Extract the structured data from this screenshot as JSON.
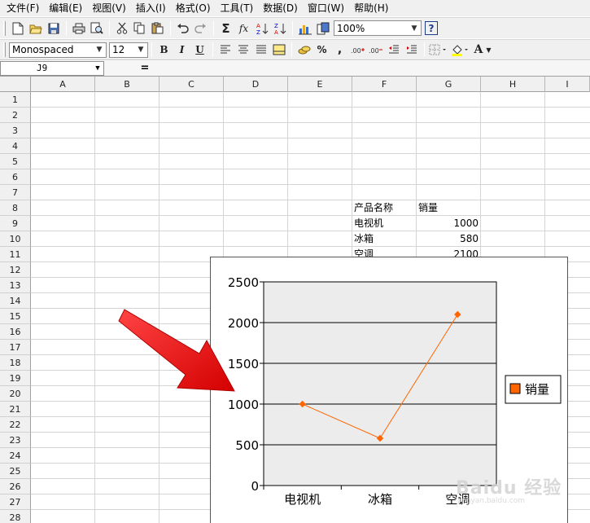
{
  "menu": [
    "文件(F)",
    "编辑(E)",
    "视图(V)",
    "插入(I)",
    "格式(O)",
    "工具(T)",
    "数据(D)",
    "窗口(W)",
    "帮助(H)"
  ],
  "toolbar1": {
    "zoom_value": "100%",
    "icons": [
      "new-file-icon",
      "open-folder-icon",
      "save-icon",
      "print-icon",
      "print-preview-icon",
      "cut-icon",
      "copy-icon",
      "paste-icon",
      "undo-icon",
      "redo-icon",
      "sum-icon",
      "function-icon",
      "sort-ascending-icon",
      "sort-descending-icon",
      "chart-icon",
      "navigator-icon",
      "help-icon"
    ],
    "sum_glyph": "Σ",
    "function_glyph": "fx",
    "help_glyph": "?"
  },
  "toolbar2": {
    "font_name": "Monospaced",
    "font_size": "12",
    "bold": "B",
    "italic": "I",
    "underline": "U",
    "percent": "%",
    "comma": ",",
    "font_color_glyph": "A"
  },
  "formula_bar": {
    "cell_ref": "J9",
    "equals": "="
  },
  "columns": [
    "A",
    "B",
    "C",
    "D",
    "E",
    "F",
    "G",
    "H",
    "I"
  ],
  "rows": [
    "1",
    "2",
    "3",
    "4",
    "5",
    "6",
    "7",
    "8",
    "9",
    "10",
    "11",
    "12",
    "13",
    "14",
    "15",
    "16",
    "17",
    "18",
    "19",
    "20",
    "21",
    "22",
    "23",
    "24",
    "25",
    "26",
    "27",
    "28"
  ],
  "cells": {
    "F8": "产品名称",
    "G8": "销量",
    "F9": "电视机",
    "G9": "1000",
    "F10": "冰箱",
    "G10": "580",
    "F11": "空调",
    "G11": "2100"
  },
  "chart_data": {
    "type": "line",
    "categories": [
      "电视机",
      "冰箱",
      "空调"
    ],
    "series": [
      {
        "name": "销量",
        "values": [
          1000,
          580,
          2100
        ],
        "color": "#ff6600"
      }
    ],
    "ylim": [
      0,
      2500
    ],
    "yticks": [
      "0",
      "500",
      "1000",
      "1500",
      "2000",
      "2500"
    ],
    "grid": true,
    "legend": "right",
    "plot_background": "#ececec"
  },
  "colors": {
    "arrow": "#ee1111",
    "series": "#ff6600",
    "toolbar_bg": "#f0f0f0"
  },
  "watermark": {
    "text": "Baidu 经验",
    "subtext": "jingyan.baidu.com"
  }
}
